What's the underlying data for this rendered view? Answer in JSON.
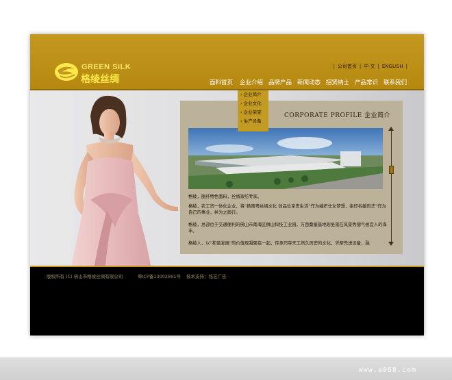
{
  "header": {
    "logo_en": "GREEN SILK",
    "logo_cn": "格绫丝绸",
    "top_links": [
      "公司首页",
      "中 文",
      "ENGLISH"
    ]
  },
  "nav": {
    "items": [
      "面料首页",
      "企业介绍",
      "品牌产品",
      "新闻动态",
      "招贤纳士",
      "产品常识",
      "联系我们"
    ]
  },
  "dropdown": {
    "items": [
      "企业简介",
      "企业文化",
      "企业荣誉",
      "生产设备"
    ]
  },
  "panel": {
    "title": "CORPORATE PROFILE 企业简介",
    "paragraphs": [
      "格绫，圈纤特色面料，丝绸家纺专家。",
      "格绫，农工贸一体化企业，将“扬南粤丝绸文化 创品位享贵生活”作为编织仕女梦想，染印名媛风华”作为自己的事业，并为之践行。",
      "格绫，总部位于交通便利的佛山市南海区狮山科技工业园，万亩桑蚕基地则坐落在风景秀丽气候宜人的海丰。",
      "格绫人，以“和谐发展”的价值观凝聚在一起，传承巧夺天工然久历史的文化，凭帮先进设备，融"
    ]
  },
  "footer": {
    "copyright": "版权所有 (C) 佛山市格绫丝绸有限公司",
    "icp": "粤ICP备13002891号",
    "support": "技术支持：铭艺广告"
  },
  "watermark": "www.a068.com",
  "colors": {
    "header_gold": "#c4991f",
    "panel_bg": "#bcb29a",
    "dress_pink": "#e9bfc0"
  }
}
